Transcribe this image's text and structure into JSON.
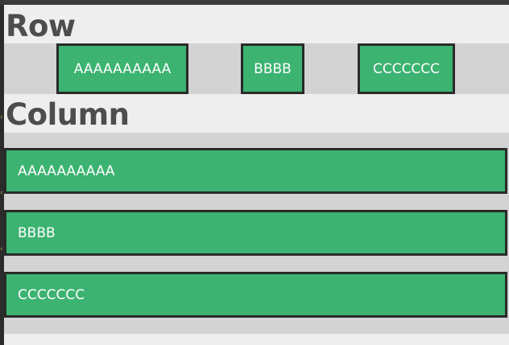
{
  "sections": {
    "row": {
      "title": "Row",
      "items": [
        "AAAAAAAAAA",
        "BBBB",
        "CCCCCCC"
      ]
    },
    "column": {
      "title": "Column",
      "items": [
        "AAAAAAAAAA",
        "BBBB",
        "CCCCCCC"
      ]
    }
  },
  "colors": {
    "box_fill": "#3cb371",
    "box_border": "#2a2a2a",
    "band": "#d3d3d3",
    "background": "#eeeeee",
    "heading_text": "#4d4d4d"
  }
}
